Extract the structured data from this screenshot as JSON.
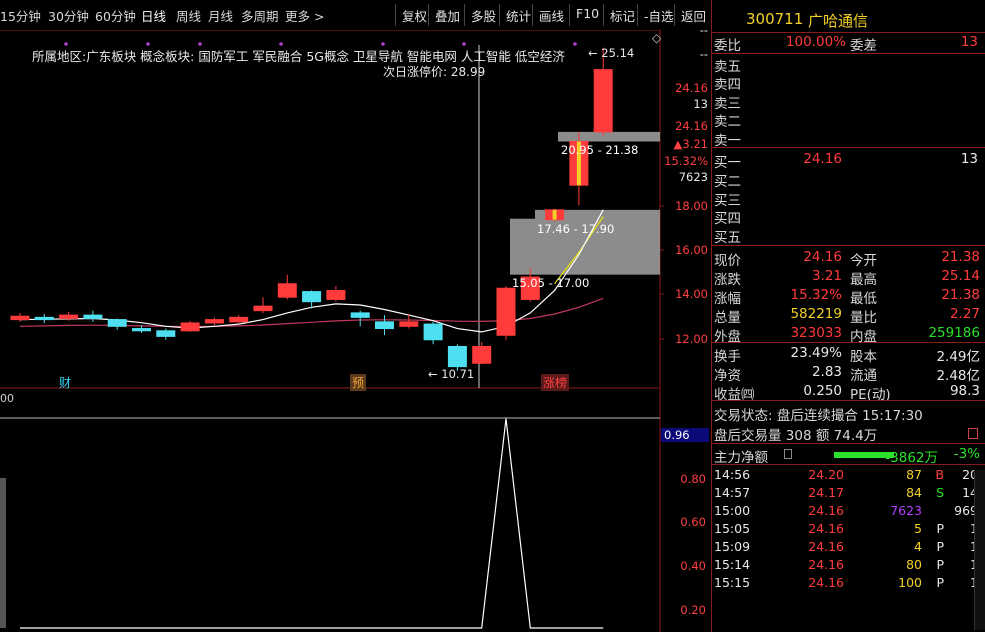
{
  "toolbar": {
    "periods": [
      {
        "label": "15分钟",
        "active": false
      },
      {
        "label": "30分钟",
        "active": false
      },
      {
        "label": "60分钟",
        "active": false
      },
      {
        "label": "日线",
        "active": true
      },
      {
        "label": "周线",
        "active": false
      },
      {
        "label": "月线",
        "active": false
      },
      {
        "label": "多周期",
        "active": false
      },
      {
        "label": "更多 >",
        "active": false
      }
    ],
    "buttons": [
      "复权",
      "叠加",
      "多股",
      "统计",
      "画线",
      "F10",
      "标记",
      "-自选",
      "返回"
    ]
  },
  "chart": {
    "info_line": "所属地区:广东板块  概念板块:  国防军工 军民融合 5G概念 卫星导航 智能电网 人工智能 低空经济",
    "limit_up_label": "次日涨停价: 28.99",
    "high_label": "25.14",
    "low_label": "10.71",
    "gap_labels": [
      "20.95 - 21.38",
      "17.46 - 17.90",
      "15.05 - 17.00"
    ],
    "markers": [
      {
        "text": "财",
        "color": "#3ad8ff"
      },
      {
        "text": "预",
        "color": "#f2a040"
      },
      {
        "text": "涨榜",
        "color": "#ff4040"
      }
    ],
    "price_axis": [
      "--",
      "--",
      "24.16",
      "13",
      "24.16",
      "▲3.21",
      "15.32%",
      "7623",
      "18.00",
      "16.00",
      "14.00",
      "12.00"
    ],
    "indicator_axis": [
      "0.96",
      "0.80",
      "0.60",
      "0.40",
      "0.20"
    ],
    "indicator_left_label": "00",
    "candles": [
      {
        "o": 13.0,
        "c": 13.15,
        "h": 13.3,
        "l": 12.9
      },
      {
        "o": 13.1,
        "c": 13.0,
        "h": 13.25,
        "l": 12.85
      },
      {
        "o": 13.05,
        "c": 13.2,
        "h": 13.35,
        "l": 12.95
      },
      {
        "o": 13.2,
        "c": 13.05,
        "h": 13.4,
        "l": 12.9
      },
      {
        "o": 13.0,
        "c": 12.7,
        "h": 13.05,
        "l": 12.55
      },
      {
        "o": 12.6,
        "c": 12.5,
        "h": 12.75,
        "l": 12.4
      },
      {
        "o": 12.5,
        "c": 12.25,
        "h": 12.6,
        "l": 12.1
      },
      {
        "o": 12.5,
        "c": 12.85,
        "h": 12.95,
        "l": 12.45
      },
      {
        "o": 12.85,
        "c": 13.0,
        "h": 13.1,
        "l": 12.75
      },
      {
        "o": 12.9,
        "c": 13.1,
        "h": 13.2,
        "l": 12.85
      },
      {
        "o": 13.4,
        "c": 13.6,
        "h": 14.0,
        "l": 13.3
      },
      {
        "o": 14.0,
        "c": 14.6,
        "h": 15.0,
        "l": 13.9
      },
      {
        "o": 14.25,
        "c": 13.8,
        "h": 14.3,
        "l": 13.5
      },
      {
        "o": 13.9,
        "c": 14.3,
        "h": 14.5,
        "l": 13.8
      },
      {
        "o": 13.3,
        "c": 13.1,
        "h": 13.4,
        "l": 12.7
      },
      {
        "o": 12.9,
        "c": 12.6,
        "h": 13.2,
        "l": 12.3
      },
      {
        "o": 12.7,
        "c": 12.9,
        "h": 13.25,
        "l": 12.6
      },
      {
        "o": 12.8,
        "c": 12.1,
        "h": 12.9,
        "l": 11.9
      },
      {
        "o": 11.8,
        "c": 10.9,
        "h": 11.9,
        "l": 10.71
      },
      {
        "o": 11.05,
        "c": 11.8,
        "h": 12.0,
        "l": 11.0
      },
      {
        "o": 12.3,
        "c": 14.4,
        "h": 14.5,
        "l": 12.1
      },
      {
        "o": 13.9,
        "c": 14.9,
        "h": 15.3,
        "l": 13.8
      },
      {
        "o": 17.46,
        "c": 17.9,
        "h": 17.95,
        "l": 17.4
      },
      {
        "o": 19.0,
        "c": 20.95,
        "h": 21.38,
        "l": 18.1
      },
      {
        "o": 21.38,
        "c": 24.16,
        "h": 25.14,
        "l": 21.2
      }
    ],
    "ma_white": [
      13.0,
      13.02,
      13.03,
      13.05,
      12.98,
      12.86,
      12.7,
      12.62,
      12.7,
      12.8,
      13.0,
      13.3,
      13.55,
      13.7,
      13.65,
      13.45,
      13.2,
      12.95,
      12.6,
      12.45,
      12.7,
      13.3,
      14.3,
      15.9,
      17.9
    ],
    "ma_yellow": [
      null,
      null,
      null,
      null,
      null,
      null,
      null,
      null,
      null,
      null,
      null,
      null,
      null,
      null,
      null,
      null,
      null,
      null,
      null,
      null,
      null,
      null,
      14.6,
      16.0,
      17.6
    ],
    "ma_purple": [
      12.7,
      12.72,
      12.74,
      12.75,
      12.74,
      12.72,
      12.7,
      12.69,
      12.7,
      12.72,
      12.76,
      12.82,
      12.88,
      12.94,
      12.98,
      12.99,
      12.98,
      12.96,
      12.93,
      12.92,
      12.95,
      13.05,
      13.25,
      13.55,
      13.95
    ],
    "indicator": [
      0,
      0,
      0,
      0,
      0,
      0,
      0,
      0,
      0,
      0,
      0,
      0,
      0,
      0,
      0,
      0,
      0,
      0,
      0,
      0,
      0.96,
      0,
      0,
      0,
      0
    ]
  },
  "panel": {
    "code": "300711",
    "name": "广哈通信",
    "webi_label": "委比",
    "webi_value": "100.00%",
    "weicha_label": "委差",
    "weicha_value": "13",
    "sells": [
      {
        "label": "卖五",
        "price": "",
        "vol": ""
      },
      {
        "label": "卖四",
        "price": "",
        "vol": ""
      },
      {
        "label": "卖三",
        "price": "",
        "vol": ""
      },
      {
        "label": "卖二",
        "price": "",
        "vol": ""
      },
      {
        "label": "卖一",
        "price": "",
        "vol": ""
      }
    ],
    "buys": [
      {
        "label": "买一",
        "price": "24.16",
        "vol": "13"
      },
      {
        "label": "买二",
        "price": "",
        "vol": ""
      },
      {
        "label": "买三",
        "price": "",
        "vol": ""
      },
      {
        "label": "买四",
        "price": "",
        "vol": ""
      },
      {
        "label": "买五",
        "price": "",
        "vol": ""
      }
    ],
    "quote": [
      {
        "l1": "现价",
        "v1": "24.16",
        "c1": "red",
        "l2": "今开",
        "v2": "21.38",
        "c2": "red"
      },
      {
        "l1": "涨跌",
        "v1": "3.21",
        "c1": "red",
        "l2": "最高",
        "v2": "25.14",
        "c2": "red"
      },
      {
        "l1": "涨幅",
        "v1": "15.32%",
        "c1": "red",
        "l2": "最低",
        "v2": "21.38",
        "c2": "red"
      },
      {
        "l1": "总量",
        "v1": "582219",
        "c1": "yellow",
        "l2": "量比",
        "v2": "2.27",
        "c2": "red"
      },
      {
        "l1": "外盘",
        "v1": "323033",
        "c1": "red",
        "l2": "内盘",
        "v2": "259186",
        "c2": "green"
      }
    ],
    "fundamentals": [
      {
        "l1": "换手",
        "v1": "23.49%",
        "l2": "股本",
        "v2": "2.49亿"
      },
      {
        "l1": "净资",
        "v1": "2.83",
        "l2": "流通",
        "v2": "2.48亿"
      },
      {
        "l1": "收益㈣",
        "v1": "0.250",
        "l2": "PE(动)",
        "v2": "98.3"
      }
    ],
    "trade_status": "交易状态: 盘后连续撮合 15:17:30",
    "after_hours": "盘后交易量 308 额 74.4万",
    "main_flow_label": "主力净额",
    "main_flow_value": "-3862万",
    "main_flow_pct": "-3%",
    "ticks": [
      {
        "time": "14:56",
        "price": "24.20",
        "vol": "87",
        "dir": "B",
        "n": "20"
      },
      {
        "time": "14:57",
        "price": "24.17",
        "vol": "84",
        "dir": "S",
        "n": "14"
      },
      {
        "time": "15:00",
        "price": "24.16",
        "vol": "7623",
        "dir": "",
        "n": "969"
      },
      {
        "time": "15:05",
        "price": "24.16",
        "vol": "5",
        "dir": "P",
        "n": "1"
      },
      {
        "time": "15:09",
        "price": "24.16",
        "vol": "4",
        "dir": "P",
        "n": "1"
      },
      {
        "time": "15:14",
        "price": "24.16",
        "vol": "80",
        "dir": "P",
        "n": "1"
      },
      {
        "time": "15:15",
        "price": "24.16",
        "vol": "100",
        "dir": "P",
        "n": "1"
      }
    ]
  }
}
